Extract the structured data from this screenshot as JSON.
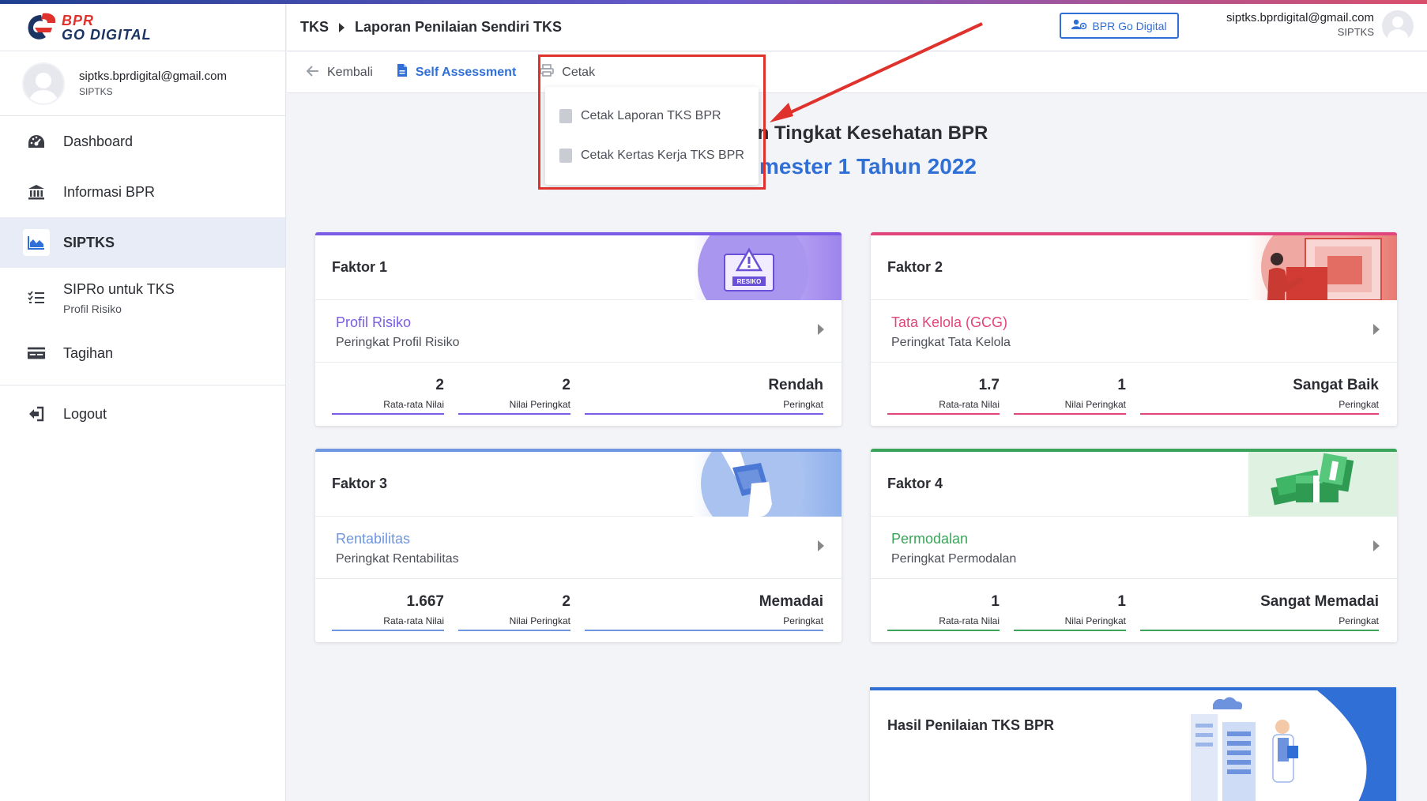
{
  "app": {
    "logo_line1": "BPR",
    "logo_line2": "GO DIGITAL"
  },
  "sidebar": {
    "user_email": "siptks.bprdigital@gmail.com",
    "user_role": "SIPTKS",
    "items": [
      {
        "label": "Dashboard",
        "icon": "gauge-icon"
      },
      {
        "label": "Informasi BPR",
        "icon": "bank-icon"
      },
      {
        "label": "SIPTKS",
        "icon": "area-chart-icon",
        "active": true
      },
      {
        "label": "SIPRo untuk TKS",
        "sub": "Profil Risiko",
        "icon": "list-check-icon"
      },
      {
        "label": "Tagihan",
        "icon": "billing-card-icon"
      }
    ],
    "logout": "Logout"
  },
  "header": {
    "crumb1": "TKS",
    "crumb2": "Laporan Penilaian Sendiri TKS",
    "bpr_button": "BPR Go Digital",
    "user_email": "siptks.bprdigital@gmail.com",
    "user_role": "SIPTKS"
  },
  "toolbar": {
    "back": "Kembali",
    "self_assessment": "Self Assessment",
    "print": "Cetak"
  },
  "dropdown": {
    "item1": "Cetak Laporan TKS BPR",
    "item2": "Cetak Kertas Kerja TKS BPR"
  },
  "page": {
    "title_visible": "ian Tingkat Kesehatan BPR",
    "subtitle_visible": "mester 1 Tahun 2022"
  },
  "cards": [
    {
      "title": "Faktor 1",
      "sub": "Profil Risiko",
      "desc": "Peringkat Profil Risiko",
      "avg": "2",
      "avg_label": "Rata-rata Nilai",
      "score": "2",
      "score_label": "Nilai Peringkat",
      "rank": "Rendah",
      "rank_label": "Peringkat",
      "art_label": "RESIKO",
      "color": "#7b5ce6"
    },
    {
      "title": "Faktor 2",
      "sub": "Tata Kelola (GCG)",
      "desc": "Peringkat Tata Kelola",
      "avg": "1.7",
      "avg_label": "Rata-rata Nilai",
      "score": "1",
      "score_label": "Nilai Peringkat",
      "rank": "Sangat Baik",
      "rank_label": "Peringkat",
      "color": "#e0457b"
    },
    {
      "title": "Faktor 3",
      "sub": "Rentabilitas",
      "desc": "Peringkat Rentabilitas",
      "avg": "1.667",
      "avg_label": "Rata-rata Nilai",
      "score": "2",
      "score_label": "Nilai Peringkat",
      "rank": "Memadai",
      "rank_label": "Peringkat",
      "color": "#6f96e0"
    },
    {
      "title": "Faktor 4",
      "sub": "Permodalan",
      "desc": "Peringkat Permodalan",
      "avg": "1",
      "avg_label": "Rata-rata Nilai",
      "score": "1",
      "score_label": "Nilai Peringkat",
      "rank": "Sangat Memadai",
      "rank_label": "Peringkat",
      "color": "#3aa55a"
    }
  ],
  "hasil": {
    "title": "Hasil Penilaian TKS BPR"
  }
}
